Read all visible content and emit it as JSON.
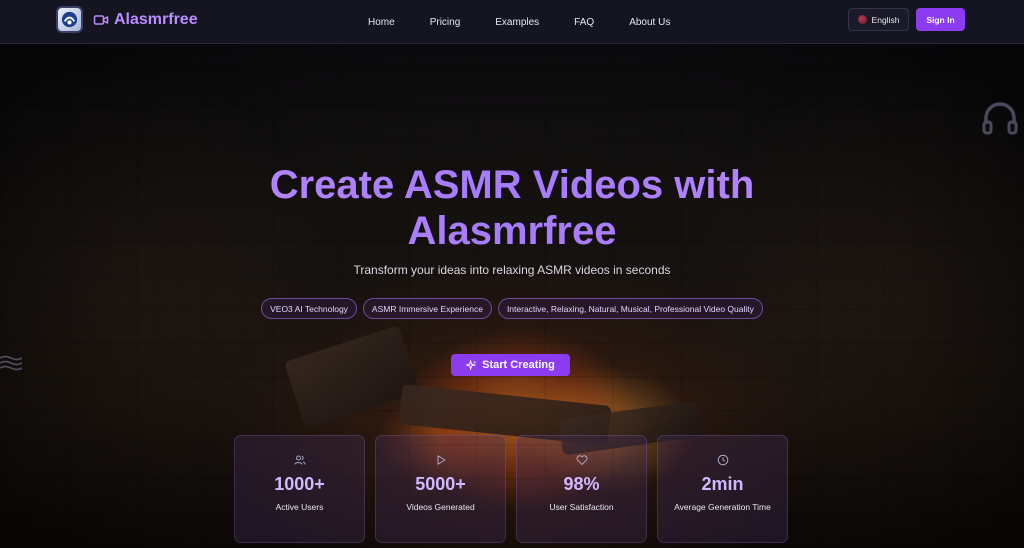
{
  "brand": {
    "name": "Alasmrfree"
  },
  "nav": [
    {
      "label": "Home"
    },
    {
      "label": "Pricing"
    },
    {
      "label": "Examples"
    },
    {
      "label": "FAQ"
    },
    {
      "label": "About Us"
    }
  ],
  "header": {
    "language": "English",
    "sign_in": "Sign In"
  },
  "hero": {
    "title_line1": "Create ASMR Videos with",
    "title_line2": "Alasmrfree",
    "subtitle": "Transform your ideas into relaxing ASMR videos in seconds",
    "tags": [
      "VEO3 AI Technology",
      "ASMR Immersive Experience",
      "Interactive, Relaxing, Natural, Musical, Professional Video Quality"
    ],
    "cta": "Start Creating"
  },
  "stats": [
    {
      "icon": "users-icon",
      "value": "1000+",
      "label": "Active Users"
    },
    {
      "icon": "play-icon",
      "value": "5000+",
      "label": "Videos Generated"
    },
    {
      "icon": "heart-icon",
      "value": "98%",
      "label": "User Satisfaction"
    },
    {
      "icon": "clock-icon",
      "value": "2min",
      "label": "Average Generation Time"
    }
  ],
  "colors": {
    "accent": "#8b3cf0",
    "brand_text": "#b98cff",
    "header_bg": "#151521"
  }
}
